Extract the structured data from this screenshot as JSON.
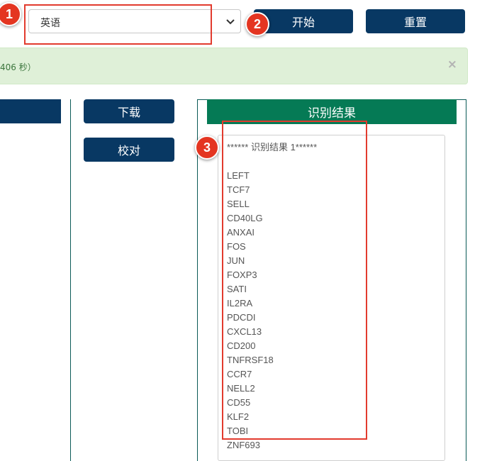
{
  "language_select": {
    "value": "英语"
  },
  "buttons": {
    "start": "开始",
    "reset": "重置",
    "download": "下载",
    "proofread": "校对"
  },
  "alert": {
    "message": "406 秒）",
    "close": "×"
  },
  "result_panel": {
    "title": "识别结果",
    "lines": [
      "****** 识别结果 1******",
      "",
      "LEFT",
      "TCF7",
      "SELL",
      "CD40LG",
      "ANXAI",
      "FOS",
      "JUN",
      "FOXP3",
      "SATI",
      "IL2RA",
      "PDCDI",
      "CXCL13",
      "CD200",
      "TNFRSF18",
      "CCR7",
      "NELL2",
      "CD55",
      "KLF2",
      "TOBI",
      "ZNF693"
    ]
  },
  "markers": [
    "1",
    "2",
    "3"
  ],
  "colors": {
    "navy": "#083863",
    "teal": "#057a55",
    "alert_bg": "#dff0d8",
    "highlight_red": "#e23b2e"
  }
}
